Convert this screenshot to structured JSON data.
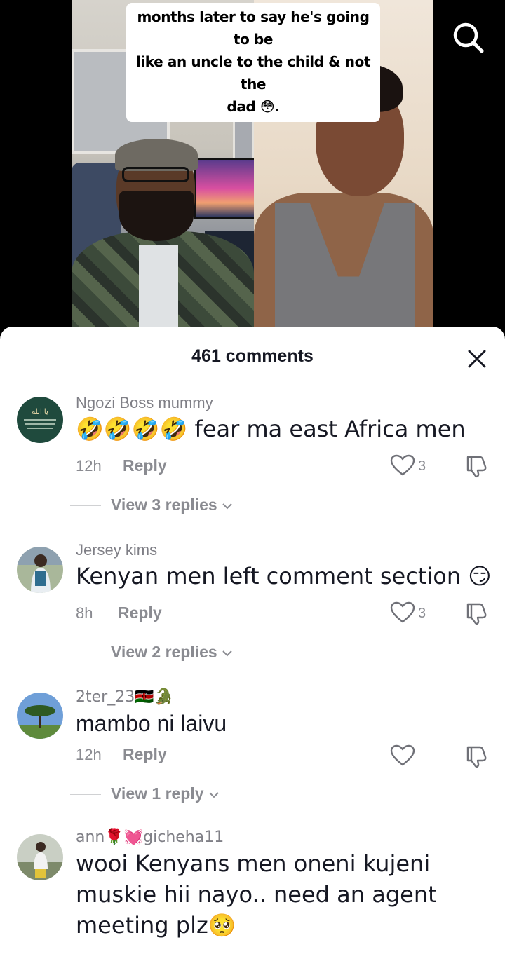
{
  "video": {
    "caption_lines": [
      "months later to say he's going to be",
      "like an uncle to the child & not the",
      "dad 😳."
    ]
  },
  "comments_header": {
    "count_label": "461 comments"
  },
  "comments": [
    {
      "username": "Ngozi Boss mummy",
      "text": "🤣🤣🤣🤣 fear ma east Africa men",
      "time": "12h",
      "reply_label": "Reply",
      "likes": "3",
      "view_replies": "View 3 replies"
    },
    {
      "username": "Jersey kims",
      "text": "Kenyan men left comment section 😏",
      "time": "8h",
      "reply_label": "Reply",
      "likes": "3",
      "view_replies": "View 2 replies"
    },
    {
      "username": "2ter_23🇰🇪🐊",
      "text": "mambo ni laivu",
      "time": "12h",
      "reply_label": "Reply",
      "likes": "",
      "view_replies": "View 1 reply"
    },
    {
      "username": "ann🌹💓gicheha11",
      "text": "wooi Kenyans men oneni kujeni muskie hii nayo.. need an agent meeting plz🥺"
    }
  ],
  "icons": {
    "search": "search-icon",
    "close": "close-icon",
    "like": "heart-outline-icon",
    "dislike": "thumbs-down-icon",
    "expand": "chevron-down-icon"
  }
}
